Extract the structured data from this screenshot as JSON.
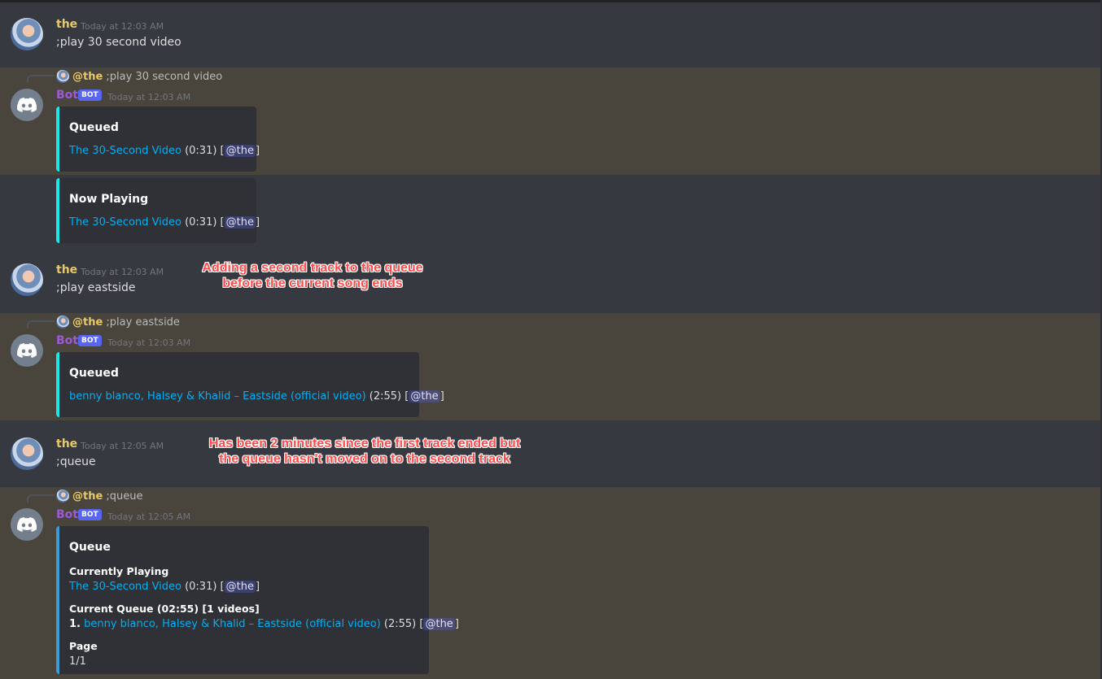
{
  "users": {
    "user_name": "the",
    "bot_name": "Bot",
    "bot_badge": "BOT"
  },
  "colors": {
    "background": "#36393f",
    "highlight": "#49443c",
    "embed_bg": "#2f3136",
    "embed_accent": "#1ee6e6",
    "link": "#00aff4",
    "annotation": "#ff4d4d"
  },
  "messages": [
    {
      "timestamp": "Today at 12:03 AM",
      "text": ";play 30 second video"
    },
    {
      "reply_mention": "@the",
      "reply_text": " ;play 30 second video",
      "timestamp": "Today at 12:03 AM",
      "embed_title": "Queued",
      "track": "The 30-Second Video",
      "duration": " (0:31) [",
      "mention": "@the",
      "close": "]"
    },
    {
      "embed_title": "Now Playing",
      "track": "The 30-Second Video",
      "duration": " (0:31) [",
      "mention": "@the",
      "close": "]"
    },
    {
      "timestamp": "Today at 12:03 AM",
      "text": ";play eastside"
    },
    {
      "reply_mention": "@the",
      "reply_text": " ;play eastside",
      "timestamp": "Today at 12:03 AM",
      "embed_title": "Queued",
      "track": "benny blanco, Halsey & Khalid – Eastside (official video)",
      "duration": " (2:55) [",
      "mention": "@the",
      "close": "]"
    },
    {
      "timestamp": "Today at 12:05 AM",
      "text": ";queue"
    },
    {
      "reply_mention": "@the",
      "reply_text": " ;queue",
      "timestamp": "Today at 12:05 AM",
      "embed_title": "Queue",
      "currently_playing_label": "Currently Playing",
      "current_track": "The 30-Second Video",
      "current_duration": " (0:31) [",
      "current_mention": "@the",
      "current_close": "]",
      "queue_label": "Current Queue (02:55) [1 videos]",
      "queue_index": "1.",
      "queue_track": "benny blanco, Halsey & Khalid – Eastside (official video)",
      "queue_duration": " (2:55) [",
      "queue_mention": "@the",
      "queue_close": "]",
      "page_label": "Page",
      "page_value": "1/1"
    }
  ],
  "annotations": {
    "first_line1": "Adding a second track to the queue",
    "first_line2": "before the current song ends",
    "second_line1": "Has been 2 minutes since the first track ended but",
    "second_line2": "the queue hasn't moved on to the second track"
  }
}
